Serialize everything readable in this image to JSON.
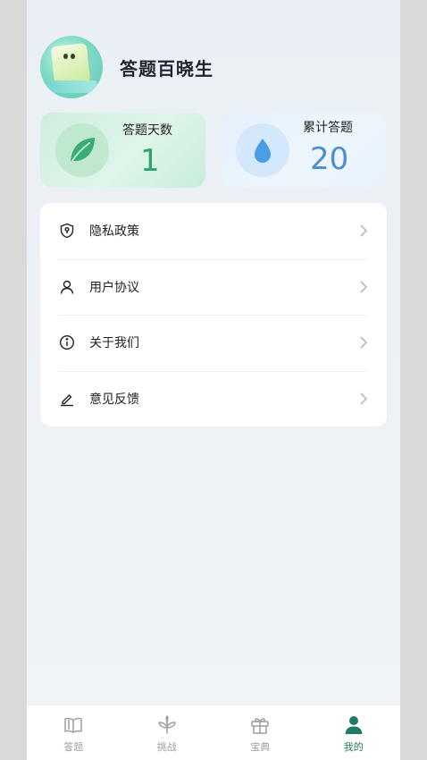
{
  "profile": {
    "username": "答题百晓生"
  },
  "stats": {
    "days": {
      "label": "答题天数",
      "value": "1"
    },
    "total": {
      "label": "累计答题",
      "value": "20"
    }
  },
  "menu": {
    "items": [
      {
        "label": "隐私政策",
        "icon": "shield-icon"
      },
      {
        "label": "用户协议",
        "icon": "user-icon"
      },
      {
        "label": "关于我们",
        "icon": "info-icon"
      },
      {
        "label": "意见反馈",
        "icon": "edit-icon"
      }
    ]
  },
  "tabbar": {
    "tabs": [
      {
        "label": "答题",
        "icon": "book-icon",
        "active": false
      },
      {
        "label": "挑战",
        "icon": "sprout-icon",
        "active": false
      },
      {
        "label": "宝典",
        "icon": "gift-icon",
        "active": false
      },
      {
        "label": "我的",
        "icon": "person-icon",
        "active": true
      }
    ]
  },
  "colors": {
    "accent": "#1f7a68",
    "days_value": "#2fa46b",
    "total_value": "#4a8fcf"
  }
}
